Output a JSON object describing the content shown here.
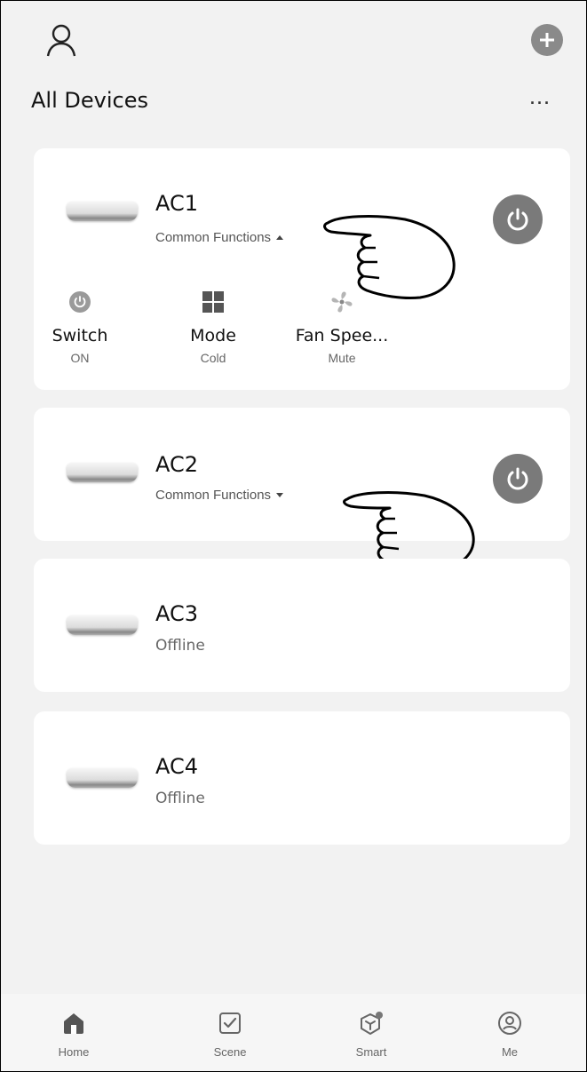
{
  "header": {
    "title": "All Devices",
    "more_label": "···",
    "profile_icon": "user-icon",
    "add_icon": "plus-circle-icon"
  },
  "devices": [
    {
      "name": "AC1",
      "subtitle": "Common Functions",
      "expanded": true,
      "power_icon": "power-icon",
      "functions": [
        {
          "label": "Switch",
          "value": "ON",
          "icon": "power-small-icon"
        },
        {
          "label": "Mode",
          "value": "Cold",
          "icon": "grid-icon"
        },
        {
          "label": "Fan Spee...",
          "value": "Mute",
          "icon": "fan-icon"
        }
      ]
    },
    {
      "name": "AC2",
      "subtitle": "Common Functions",
      "expanded": false,
      "power_icon": "power-icon"
    },
    {
      "name": "AC3",
      "status": "Offline"
    },
    {
      "name": "AC4",
      "status": "Offline"
    }
  ],
  "bottom_nav": [
    {
      "label": "Home",
      "icon": "home-icon",
      "active": true
    },
    {
      "label": "Scene",
      "icon": "checkbox-icon",
      "active": false
    },
    {
      "label": "Smart",
      "icon": "smart-cube-icon",
      "active": false
    },
    {
      "label": "Me",
      "icon": "account-circle-icon",
      "active": false
    }
  ],
  "colors": {
    "background": "#f2f2f2",
    "card": "#ffffff",
    "power_button": "#7a7a7a",
    "text_primary": "#111111",
    "text_secondary": "#666666"
  }
}
